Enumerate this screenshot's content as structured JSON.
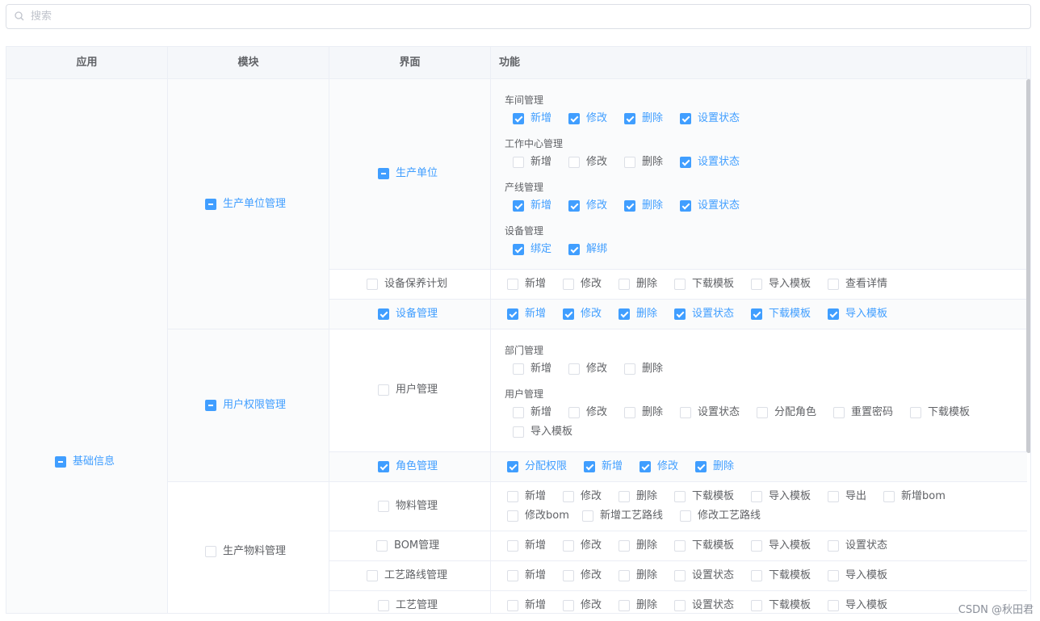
{
  "search": {
    "placeholder": "搜索",
    "value": ""
  },
  "columns": [
    "应用",
    "模块",
    "界面",
    "功能"
  ],
  "app": {
    "label": "基础信息",
    "state": "ind"
  },
  "modules": [
    {
      "label": "生产单位管理",
      "state": "ind"
    },
    {
      "label": "用户权限管理",
      "state": "ind"
    },
    {
      "label": "生产物料管理",
      "state": "off"
    }
  ],
  "screens": [
    {
      "label": "生产单位",
      "state": "ind"
    },
    {
      "label": "设备保养计划",
      "state": "off"
    },
    {
      "label": "设备管理",
      "state": "on"
    },
    {
      "label": "用户管理",
      "state": "off"
    },
    {
      "label": "角色管理",
      "state": "on"
    },
    {
      "label": "物料管理",
      "state": "off"
    },
    {
      "label": "BOM管理",
      "state": "off"
    },
    {
      "label": "工艺路线管理",
      "state": "off"
    },
    {
      "label": "工艺管理",
      "state": "off"
    }
  ],
  "groups": [
    {
      "title": "车间管理",
      "items": [
        [
          "新增",
          "on"
        ],
        [
          "修改",
          "on"
        ],
        [
          "删除",
          "on"
        ],
        [
          "设置状态",
          "on"
        ]
      ]
    },
    {
      "title": "工作中心管理",
      "items": [
        [
          "新增",
          "off"
        ],
        [
          "修改",
          "off"
        ],
        [
          "删除",
          "off"
        ],
        [
          "设置状态",
          "on"
        ]
      ]
    },
    {
      "title": "产线管理",
      "items": [
        [
          "新增",
          "on"
        ],
        [
          "修改",
          "on"
        ],
        [
          "删除",
          "on"
        ],
        [
          "设置状态",
          "on"
        ]
      ]
    },
    {
      "title": "设备管理",
      "items": [
        [
          "绑定",
          "on"
        ],
        [
          "解绑",
          "on"
        ]
      ]
    },
    {
      "title": "部门管理",
      "items": [
        [
          "新增",
          "off"
        ],
        [
          "修改",
          "off"
        ],
        [
          "删除",
          "off"
        ]
      ]
    },
    {
      "title": "用户管理",
      "items": [
        [
          "新增",
          "off"
        ],
        [
          "修改",
          "off"
        ],
        [
          "删除",
          "off"
        ],
        [
          "设置状态",
          "off"
        ],
        [
          "分配角色",
          "off"
        ],
        [
          "重置密码",
          "off"
        ],
        [
          "下载模板",
          "off"
        ],
        [
          "导入模板",
          "off"
        ]
      ]
    }
  ],
  "funcs": [
    {
      "items": [
        [
          "新增",
          "off"
        ],
        [
          "修改",
          "off"
        ],
        [
          "删除",
          "off"
        ],
        [
          "下载模板",
          "off"
        ],
        [
          "导入模板",
          "off"
        ],
        [
          "查看详情",
          "off"
        ]
      ]
    },
    {
      "items": [
        [
          "新增",
          "on"
        ],
        [
          "修改",
          "on"
        ],
        [
          "删除",
          "on"
        ],
        [
          "设置状态",
          "on"
        ],
        [
          "下载模板",
          "on"
        ],
        [
          "导入模板",
          "on"
        ]
      ]
    },
    {
      "items": [
        [
          "分配权限",
          "on"
        ],
        [
          "新增",
          "on"
        ],
        [
          "修改",
          "on"
        ],
        [
          "删除",
          "on"
        ]
      ]
    },
    {
      "items": [
        [
          "新增",
          "off"
        ],
        [
          "修改",
          "off"
        ],
        [
          "删除",
          "off"
        ],
        [
          "下载模板",
          "off"
        ],
        [
          "导入模板",
          "off"
        ],
        [
          "导出",
          "off"
        ],
        [
          "新增bom",
          "off"
        ],
        [
          "修改bom",
          "off"
        ],
        [
          "新增工艺路线",
          "off"
        ],
        [
          "修改工艺路线",
          "off"
        ]
      ]
    },
    {
      "items": [
        [
          "新增",
          "off"
        ],
        [
          "修改",
          "off"
        ],
        [
          "删除",
          "off"
        ],
        [
          "下载模板",
          "off"
        ],
        [
          "导入模板",
          "off"
        ],
        [
          "设置状态",
          "off"
        ]
      ]
    },
    {
      "items": [
        [
          "新增",
          "off"
        ],
        [
          "修改",
          "off"
        ],
        [
          "删除",
          "off"
        ],
        [
          "设置状态",
          "off"
        ],
        [
          "下载模板",
          "off"
        ],
        [
          "导入模板",
          "off"
        ]
      ]
    },
    {
      "items": [
        [
          "新增",
          "off"
        ],
        [
          "修改",
          "off"
        ],
        [
          "删除",
          "off"
        ],
        [
          "设置状态",
          "off"
        ],
        [
          "下载模板",
          "off"
        ],
        [
          "导入模板",
          "off"
        ]
      ]
    }
  ],
  "watermark": "CSDN @秋田君",
  "colors": {
    "accent": "#409eff",
    "border": "#ebeef5",
    "header_bg": "#f5f7fa"
  }
}
